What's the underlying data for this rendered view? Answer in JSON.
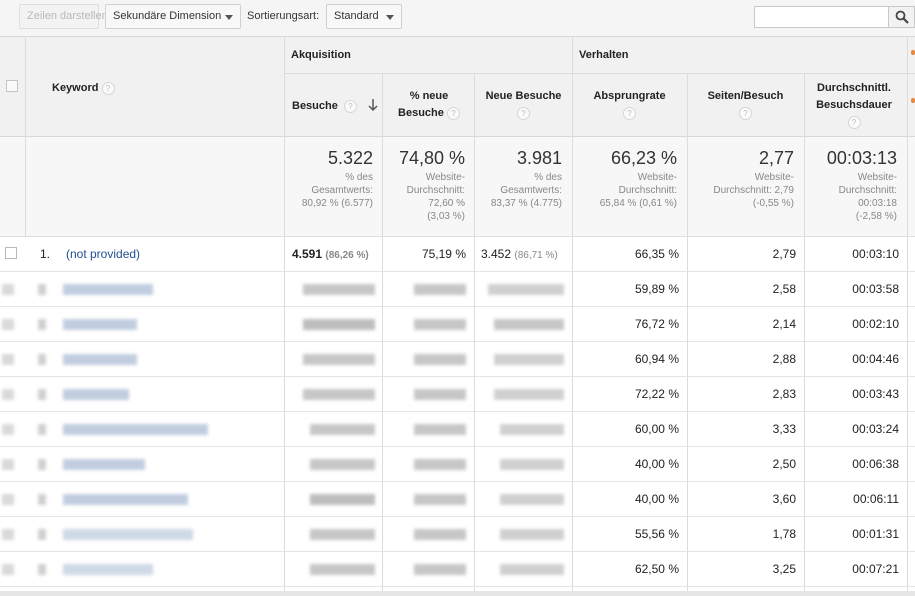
{
  "toolbar": {
    "show_rows": "Zeilen darstellen",
    "secondary_dimension": "Sekundäre Dimension",
    "sort_label": "Sortierungsart:",
    "sort_value": "Standard",
    "search_value": ""
  },
  "header": {
    "keyword": "Keyword",
    "group_acquisition": "Akquisition",
    "group_behavior": "Verhalten",
    "visits": "Besuche",
    "new_visits_pct_l1": "% neue",
    "new_visits_pct_l2": "Besuche",
    "new_visits": "Neue Besuche",
    "bounce_rate": "Absprungrate",
    "pages_visit": "Seiten/Besuch",
    "avg_duration_l1": "Durchschnittl.",
    "avg_duration_l2": "Besuchsdauer",
    "help": "?"
  },
  "totals": {
    "visits": {
      "value": "5.322",
      "l1": "% des",
      "l2": "Gesamtwerts:",
      "l3": "80,92 % (6.577)"
    },
    "new_pct": {
      "value": "74,80 %",
      "l1": "Website-",
      "l2": "Durchschnitt:",
      "l3": "72,60 %",
      "l4": "(3,03 %)"
    },
    "new_visits": {
      "value": "3.981",
      "l1": "% des",
      "l2": "Gesamtwerts:",
      "l3": "83,37 % (4.775)"
    },
    "bounce": {
      "value": "66,23 %",
      "l1": "Website-",
      "l2": "Durchschnitt:",
      "l3": "65,84 % (0,61 %)"
    },
    "pages": {
      "value": "2,77",
      "l1": "Website-",
      "l2": "Durchschnitt: 2,79",
      "l3": "(-0,55 %)"
    },
    "duration": {
      "value": "00:03:13",
      "l1": "Website-",
      "l2": "Durchschnitt:",
      "l3": "00:03:18",
      "l4": "(-2,58 %)"
    }
  },
  "first_row": {
    "index": "1.",
    "keyword": "(not provided)",
    "visits": "4.591",
    "visits_pct": "(86,26 %)",
    "new_pct": "75,19 %",
    "new_visits": "3.452",
    "new_visits_pct": "(86,71 %)",
    "bounce": "66,35 %",
    "pages": "2,79",
    "duration": "00:03:10"
  },
  "rows": [
    {
      "bounce": "59,89 %",
      "pages": "2,58",
      "duration": "00:03:58"
    },
    {
      "bounce": "76,72 %",
      "pages": "2,14",
      "duration": "00:02:10"
    },
    {
      "bounce": "60,94 %",
      "pages": "2,88",
      "duration": "00:04:46"
    },
    {
      "bounce": "72,22 %",
      "pages": "2,83",
      "duration": "00:03:43"
    },
    {
      "bounce": "60,00 %",
      "pages": "3,33",
      "duration": "00:03:24"
    },
    {
      "bounce": "40,00 %",
      "pages": "2,50",
      "duration": "00:06:38"
    },
    {
      "bounce": "40,00 %",
      "pages": "3,60",
      "duration": "00:06:11"
    },
    {
      "bounce": "55,56 %",
      "pages": "1,78",
      "duration": "00:01:31"
    },
    {
      "bounce": "62,50 %",
      "pages": "3,25",
      "duration": "00:07:21"
    }
  ]
}
